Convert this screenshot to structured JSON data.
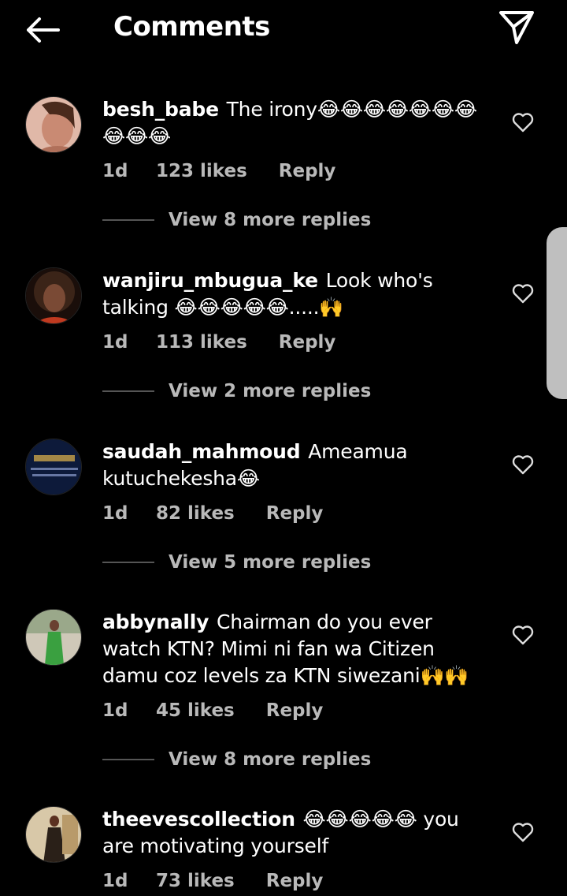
{
  "header": {
    "title": "Comments",
    "back_icon": "arrow-left-icon",
    "send_icon": "paper-plane-icon"
  },
  "comments": [
    {
      "username": "besh_babe",
      "text": "The irony😂😂😂😂😂😂😂😂😂😂",
      "time": "1d",
      "likes": "123 likes",
      "reply": "Reply",
      "view_replies": "View 8 more replies",
      "avatar_color": "#c98a73"
    },
    {
      "username": "wanjiru_mbugua_ke",
      "text": "Look who's talking 😂😂😂😂😂.....🙌",
      "time": "1d",
      "likes": "113 likes",
      "reply": "Reply",
      "view_replies": "View 2 more replies",
      "avatar_color": "#5a3a2c"
    },
    {
      "username": "saudah_mahmoud",
      "text": "Ameamua kutuchekesha😂",
      "time": "1d",
      "likes": "82 likes",
      "reply": "Reply",
      "view_replies": "View 5 more replies",
      "avatar_color": "#0d1a3a"
    },
    {
      "username": "abbynally",
      "text": "Chairman do you ever watch KTN? Mimi ni fan wa Citizen damu coz levels za KTN siwezani🙌🙌",
      "time": "1d",
      "likes": "45 likes",
      "reply": "Reply",
      "view_replies": "View 8 more replies",
      "avatar_color": "#8a9a7a"
    },
    {
      "username": "theevescollection",
      "text": "😂😂😂😂😂 you are motivating yourself",
      "time": "1d",
      "likes": "73 likes",
      "reply": "Reply",
      "avatar_color": "#b89a6a"
    }
  ],
  "icons": {
    "like": "heart-outline-icon"
  },
  "colors": {
    "background": "#000000",
    "text": "#ffffff",
    "secondary_text": "#b9b9b9",
    "divider": "#555555"
  }
}
